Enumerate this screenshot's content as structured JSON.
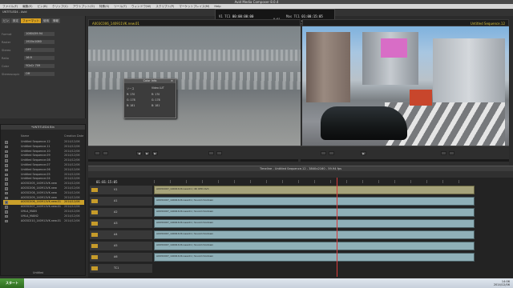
{
  "window": {
    "title": "Avid Media Composer 8.0.4"
  },
  "menu": [
    "ファイル(F)",
    "編集(E)",
    "ビン(B)",
    "クリップ(C)",
    "アウトプット(O)",
    "特殊(S)",
    "ツール(T)",
    "ウィンドウ(W)",
    "スクリプト(P)",
    "マーケットプレイス(M)",
    "Help"
  ],
  "project": {
    "title": "UNTITLED4 - Avid"
  },
  "project_tabs": [
    "ビン",
    "設定",
    "フォーマット",
    "使用",
    "情報"
  ],
  "project_settings": [
    {
      "label": "Format",
      "value": "1080i/59.94"
    },
    {
      "label": "Raster",
      "value": "1920x1080"
    },
    {
      "label": "Stereo",
      "value": "OFF"
    },
    {
      "label": "Ratio",
      "value": "16:9"
    },
    {
      "label": "Color",
      "value": "YCbCr 709"
    },
    {
      "label": "Stereoscopic",
      "value": "Off"
    }
  ],
  "toolbar": {
    "title": "コンポーザー"
  },
  "timecode": {
    "row1": [
      {
        "label": "V1 TC1",
        "value": "00:00:00:00"
      },
      {
        "label": "Mas TC1",
        "value": "01:00:15:05"
      }
    ],
    "row2": [
      {
        "label": "A1 TC1",
        "value": "00:00:00:00"
      },
      {
        "label": "Mas TC1",
        "value": "01:00:15:05"
      }
    ],
    "mid": "0:01"
  },
  "source_monitor": {
    "clip_name": "A003C006_140911VK.new.01"
  },
  "record_monitor": {
    "clip_name": "Untitled Sequence.12"
  },
  "color_info": {
    "title": "Color Info",
    "header_left": "ソース",
    "header_right": "Video LUT",
    "rows": [
      {
        "l": "R: 170",
        "r": "R: 170"
      },
      {
        "l": "G: 178",
        "r": "G: 178"
      },
      {
        "l": "B: 181",
        "r": "B: 181"
      }
    ]
  },
  "bin": {
    "title": "*UNTITLED4 Bin",
    "columns": [
      "Name",
      "Creation Date"
    ],
    "rows": [
      {
        "name": "Untitled Sequence.12",
        "date": "2014/12/06"
      },
      {
        "name": "Untitled Sequence.11",
        "date": "2014/12/06"
      },
      {
        "name": "Untitled Sequence.10",
        "date": "2014/12/06"
      },
      {
        "name": "Untitled Sequence.09",
        "date": "2014/12/06"
      },
      {
        "name": "Untitled Sequence.08",
        "date": "2014/12/06"
      },
      {
        "name": "Untitled Sequence.07",
        "date": "2014/12/06"
      },
      {
        "name": "Untitled Sequence.06",
        "date": "2014/12/06"
      },
      {
        "name": "Untitled Sequence.05",
        "date": "2014/12/06"
      },
      {
        "name": "Untitled Sequence.04",
        "date": "2014/12/06"
      },
      {
        "name": "A003C005_140911VK.new",
        "date": "2014/12/06"
      },
      {
        "name": "A003C006_140911VK.new",
        "date": "2014/12/06"
      },
      {
        "name": "A003C008_140911VK.new",
        "date": "2014/12/06"
      },
      {
        "name": "A003C009_140911VK.new",
        "date": "2014/12/06"
      },
      {
        "name": "A003C006_140911VK.new.01",
        "date": "2014/12/06",
        "selected": true
      },
      {
        "name": "A003C007_140911VK.new.01",
        "date": "2014/12/06"
      },
      {
        "name": "UHLA_MAIN",
        "date": "2014/12/06"
      },
      {
        "name": "UHLA_MAIN2",
        "date": "2014/12/06"
      },
      {
        "name": "A003C010_140911VK.new.01",
        "date": "2014/12/06"
      }
    ],
    "footer": "Untitled"
  },
  "timeline": {
    "title": "Timeline - Untitled Sequence.12 - 3840x2160 - 59.94 fps",
    "timecode": "01:01:15:05",
    "tracks": [
      {
        "name": "V1",
        "clip": "A003C007_140911VK.new.01 / 4K UHD AVC",
        "type": "v"
      },
      {
        "name": "A1",
        "clip": "A003C007_140911VK.new.01 / Sound mixdown",
        "type": "a"
      },
      {
        "name": "A2",
        "clip": "A003C007_140911VK.new.01 / Sound mixdown",
        "type": "a"
      },
      {
        "name": "A3",
        "clip": "A003C007_140911VK.new.01 / Sound mixdown",
        "type": "a"
      },
      {
        "name": "A4",
        "clip": "A003C007_140911VK.new.01 / Sound mixdown",
        "type": "a"
      },
      {
        "name": "A5",
        "clip": "A003C007_140911VK.new.01 / Sound mixdown",
        "type": "a"
      },
      {
        "name": "A6",
        "clip": "A003C007_140911VK.new.01 / Sound mixdown",
        "type": "a"
      },
      {
        "name": "TC1",
        "clip": "",
        "type": "t"
      }
    ]
  },
  "taskbar": {
    "start": "スタート",
    "time": "14:06",
    "date": "2014/12/06"
  }
}
